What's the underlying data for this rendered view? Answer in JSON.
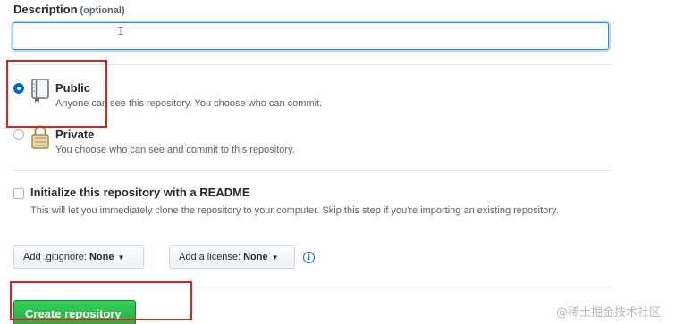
{
  "description": {
    "label": "Description",
    "optional_tag": "(optional)",
    "value": ""
  },
  "visibility": {
    "options": [
      {
        "title": "Public",
        "description": "Anyone can see this repository. You choose who can commit.",
        "selected": true
      },
      {
        "title": "Private",
        "description": "You choose who can see and commit to this repository.",
        "selected": false
      }
    ]
  },
  "readme": {
    "label": "Initialize this repository with a README",
    "description": "This will let you immediately clone the repository to your computer. Skip this step if you're importing an existing repository.",
    "checked": false
  },
  "gitignore": {
    "label": "Add .gitignore:",
    "value": "None"
  },
  "license": {
    "label": "Add a license:",
    "value": "None"
  },
  "info_icon": "i",
  "create_button": {
    "label": "Create repository"
  },
  "watermark": "@稀土掘金技术社区",
  "colors": {
    "primary_blue": "#0366d6",
    "success_green": "#28a745",
    "highlight_red": "#e0201b"
  }
}
